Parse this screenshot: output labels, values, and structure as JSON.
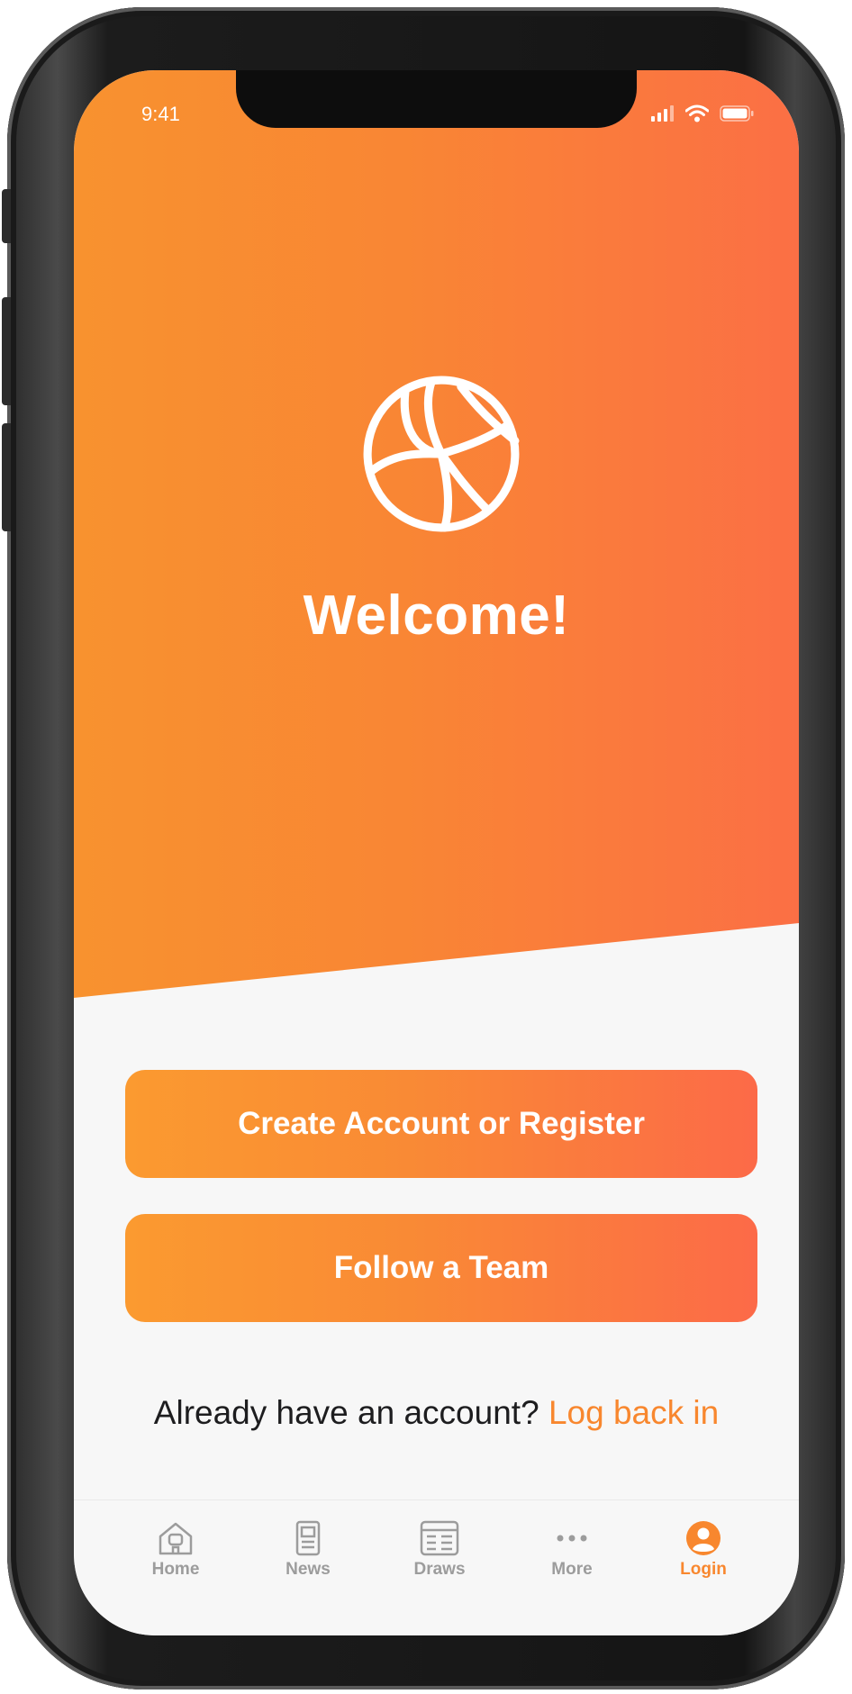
{
  "status_bar": {
    "time": "9:41"
  },
  "hero": {
    "logo_icon": "volleyball-icon",
    "title": "Welcome!"
  },
  "actions": {
    "create_account_label": "Create Account or Register",
    "follow_team_label": "Follow a Team"
  },
  "login_prompt": {
    "text": "Already have an account?",
    "link_label": "Log back in"
  },
  "tab_bar": {
    "active": "Login",
    "items": [
      {
        "label": "Home",
        "icon": "home-icon"
      },
      {
        "label": "News",
        "icon": "news-icon"
      },
      {
        "label": "Draws",
        "icon": "draws-icon"
      },
      {
        "label": "More",
        "icon": "more-icon"
      },
      {
        "label": "Login",
        "icon": "user-icon"
      }
    ]
  },
  "colors": {
    "accent": "#f8872e",
    "gradient_start": "#f8922f",
    "gradient_end": "#fb6f45",
    "background": "#f7f7f7",
    "inactive_tab": "#9c9c9c"
  }
}
